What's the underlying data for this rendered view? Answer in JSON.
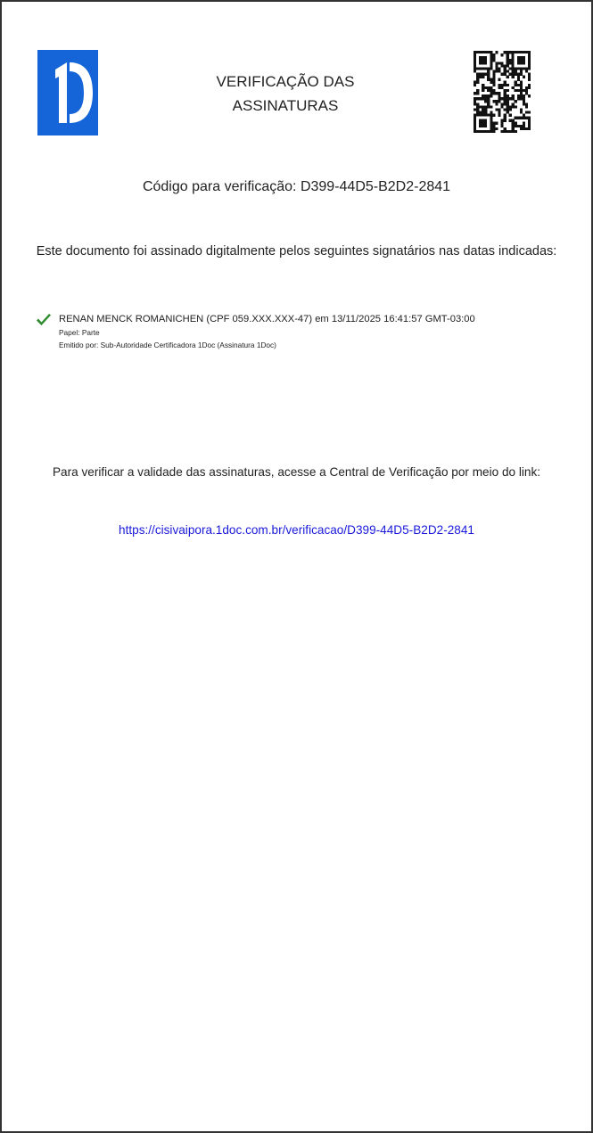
{
  "header": {
    "logo_icon": "1doc-logo-icon",
    "logo_color": "#1565d8",
    "title_line1": "VERIFICAÇÃO DAS",
    "title_line2": "ASSINATURAS",
    "qr_icon": "qr-code-icon"
  },
  "verification_code": "Código para verificação: D399-44D5-B2D2-2841",
  "intro_text": "Este documento foi assinado digitalmente pelos seguintes signatários nas datas indicadas:",
  "signatures": [
    {
      "status_icon": "check-icon",
      "status_color": "#2e8b2e",
      "line": "RENAN MENCK ROMANICHEN (CPF 059.XXX.XXX-47) em 13/11/2025 16:41:57 GMT-03:00",
      "role": "Papel: Parte",
      "issuer": "Emitido por: Sub-Autoridade Certificadora 1Doc (Assinatura 1Doc)"
    }
  ],
  "verify_text": "Para verificar a validade das assinaturas, acesse a Central de Verificação por meio do link:",
  "verify_link": "https://cisivaipora.1doc.com.br/verificacao/D399-44D5-B2D2-2841",
  "link_color": "#1a1adb"
}
